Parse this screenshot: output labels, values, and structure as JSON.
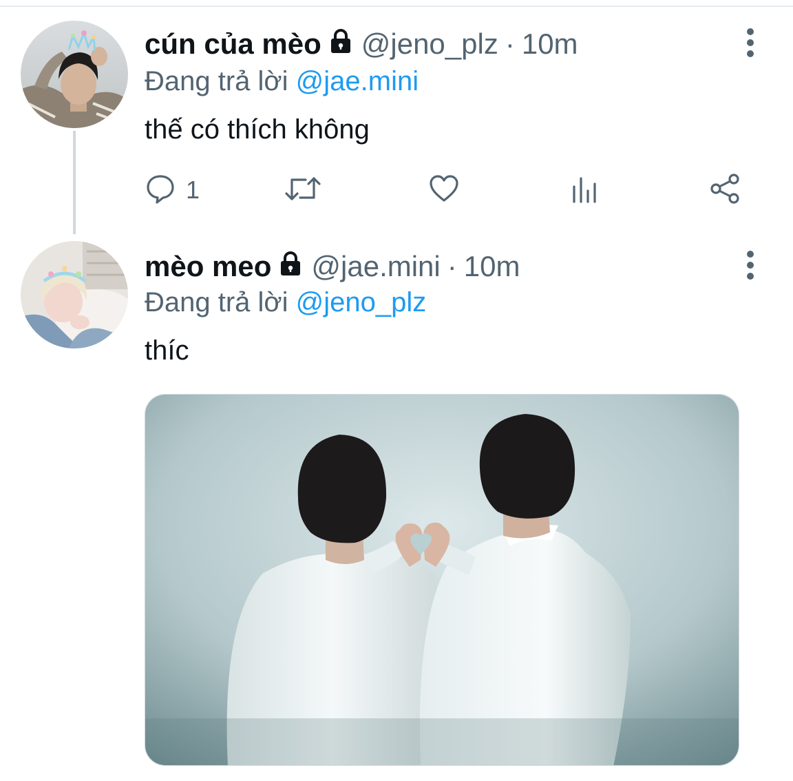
{
  "tweets": [
    {
      "display_name": "cún của mèo",
      "handle": "@jeno_plz",
      "separator": "·",
      "time": "10m",
      "reply_prefix": "Đang trả lời",
      "reply_to": "@jae.mini",
      "text": "thế có thích không",
      "actions": {
        "reply_count": "1"
      }
    },
    {
      "display_name": "mèo meo",
      "handle": "@jae.mini",
      "separator": "·",
      "time": "10m",
      "reply_prefix": "Đang trả lời",
      "reply_to": "@jeno_plz",
      "text": "thíc"
    }
  ],
  "colors": {
    "text_primary": "#0f1419",
    "text_secondary": "#536471",
    "link": "#1d9bf0",
    "divider": "#cfd9de"
  },
  "icons": {
    "lock": "lock-icon",
    "more": "more-vertical-icon",
    "reply": "reply-icon",
    "retweet": "retweet-icon",
    "like": "heart-icon",
    "analytics": "analytics-icon",
    "share": "share-icon"
  }
}
